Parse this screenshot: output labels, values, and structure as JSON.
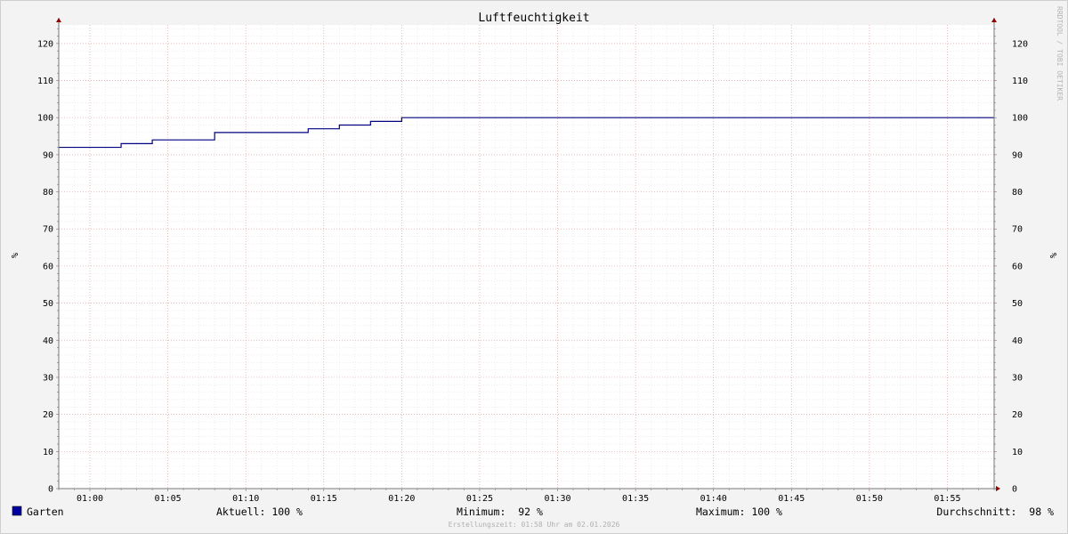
{
  "chart_data": {
    "type": "line",
    "title": "Luftfeuchtigkeit",
    "ylabel": "%",
    "ylabel_right": "%",
    "ylim": [
      0,
      125
    ],
    "y_ticks": [
      0,
      10,
      20,
      30,
      40,
      50,
      60,
      70,
      80,
      90,
      100,
      110,
      120
    ],
    "xlim": [
      "00:58",
      "01:58"
    ],
    "x_ticks": [
      "01:00",
      "01:05",
      "01:10",
      "01:15",
      "01:20",
      "01:25",
      "01:30",
      "01:35",
      "01:40",
      "01:45",
      "01:50",
      "01:55"
    ],
    "grid": true,
    "watermark": "RRDTOOL / TOBI OETIKER",
    "series": [
      {
        "name": "Garten",
        "color": "#000080",
        "step": true,
        "points": [
          [
            "00:58",
            92
          ],
          [
            "01:02",
            93
          ],
          [
            "01:04",
            94
          ],
          [
            "01:08",
            96
          ],
          [
            "01:14",
            97
          ],
          [
            "01:16",
            98
          ],
          [
            "01:18",
            99
          ],
          [
            "01:20",
            100
          ],
          [
            "01:58",
            100
          ]
        ]
      }
    ],
    "legend": {
      "series_name": "Garten",
      "color": "#0000a0",
      "stats": [
        {
          "label": "Aktuell:",
          "value": "100 %"
        },
        {
          "label": "Minimum:",
          "value": "92 %"
        },
        {
          "label": "Maximum:",
          "value": "100 %"
        },
        {
          "label": "Durchschnitt:",
          "value": "98 %"
        }
      ]
    },
    "footer": "Erstellungszeit: 01:58 Uhr am 02.01.2026"
  }
}
